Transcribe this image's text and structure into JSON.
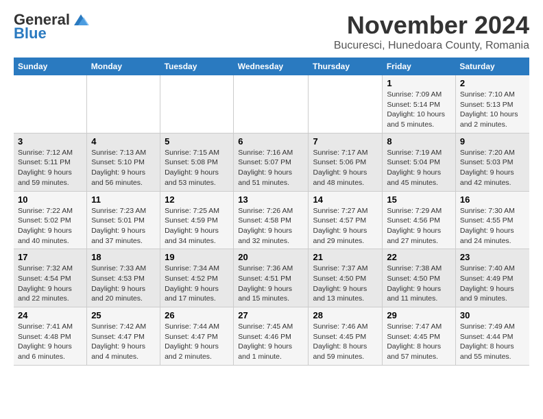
{
  "header": {
    "logo_general": "General",
    "logo_blue": "Blue",
    "month_title": "November 2024",
    "location": "Bucuresci, Hunedoara County, Romania"
  },
  "days_of_week": [
    "Sunday",
    "Monday",
    "Tuesday",
    "Wednesday",
    "Thursday",
    "Friday",
    "Saturday"
  ],
  "weeks": [
    [
      {
        "day": "",
        "info": ""
      },
      {
        "day": "",
        "info": ""
      },
      {
        "day": "",
        "info": ""
      },
      {
        "day": "",
        "info": ""
      },
      {
        "day": "",
        "info": ""
      },
      {
        "day": "1",
        "info": "Sunrise: 7:09 AM\nSunset: 5:14 PM\nDaylight: 10 hours\nand 5 minutes."
      },
      {
        "day": "2",
        "info": "Sunrise: 7:10 AM\nSunset: 5:13 PM\nDaylight: 10 hours\nand 2 minutes."
      }
    ],
    [
      {
        "day": "3",
        "info": "Sunrise: 7:12 AM\nSunset: 5:11 PM\nDaylight: 9 hours\nand 59 minutes."
      },
      {
        "day": "4",
        "info": "Sunrise: 7:13 AM\nSunset: 5:10 PM\nDaylight: 9 hours\nand 56 minutes."
      },
      {
        "day": "5",
        "info": "Sunrise: 7:15 AM\nSunset: 5:08 PM\nDaylight: 9 hours\nand 53 minutes."
      },
      {
        "day": "6",
        "info": "Sunrise: 7:16 AM\nSunset: 5:07 PM\nDaylight: 9 hours\nand 51 minutes."
      },
      {
        "day": "7",
        "info": "Sunrise: 7:17 AM\nSunset: 5:06 PM\nDaylight: 9 hours\nand 48 minutes."
      },
      {
        "day": "8",
        "info": "Sunrise: 7:19 AM\nSunset: 5:04 PM\nDaylight: 9 hours\nand 45 minutes."
      },
      {
        "day": "9",
        "info": "Sunrise: 7:20 AM\nSunset: 5:03 PM\nDaylight: 9 hours\nand 42 minutes."
      }
    ],
    [
      {
        "day": "10",
        "info": "Sunrise: 7:22 AM\nSunset: 5:02 PM\nDaylight: 9 hours\nand 40 minutes."
      },
      {
        "day": "11",
        "info": "Sunrise: 7:23 AM\nSunset: 5:01 PM\nDaylight: 9 hours\nand 37 minutes."
      },
      {
        "day": "12",
        "info": "Sunrise: 7:25 AM\nSunset: 4:59 PM\nDaylight: 9 hours\nand 34 minutes."
      },
      {
        "day": "13",
        "info": "Sunrise: 7:26 AM\nSunset: 4:58 PM\nDaylight: 9 hours\nand 32 minutes."
      },
      {
        "day": "14",
        "info": "Sunrise: 7:27 AM\nSunset: 4:57 PM\nDaylight: 9 hours\nand 29 minutes."
      },
      {
        "day": "15",
        "info": "Sunrise: 7:29 AM\nSunset: 4:56 PM\nDaylight: 9 hours\nand 27 minutes."
      },
      {
        "day": "16",
        "info": "Sunrise: 7:30 AM\nSunset: 4:55 PM\nDaylight: 9 hours\nand 24 minutes."
      }
    ],
    [
      {
        "day": "17",
        "info": "Sunrise: 7:32 AM\nSunset: 4:54 PM\nDaylight: 9 hours\nand 22 minutes."
      },
      {
        "day": "18",
        "info": "Sunrise: 7:33 AM\nSunset: 4:53 PM\nDaylight: 9 hours\nand 20 minutes."
      },
      {
        "day": "19",
        "info": "Sunrise: 7:34 AM\nSunset: 4:52 PM\nDaylight: 9 hours\nand 17 minutes."
      },
      {
        "day": "20",
        "info": "Sunrise: 7:36 AM\nSunset: 4:51 PM\nDaylight: 9 hours\nand 15 minutes."
      },
      {
        "day": "21",
        "info": "Sunrise: 7:37 AM\nSunset: 4:50 PM\nDaylight: 9 hours\nand 13 minutes."
      },
      {
        "day": "22",
        "info": "Sunrise: 7:38 AM\nSunset: 4:50 PM\nDaylight: 9 hours\nand 11 minutes."
      },
      {
        "day": "23",
        "info": "Sunrise: 7:40 AM\nSunset: 4:49 PM\nDaylight: 9 hours\nand 9 minutes."
      }
    ],
    [
      {
        "day": "24",
        "info": "Sunrise: 7:41 AM\nSunset: 4:48 PM\nDaylight: 9 hours\nand 6 minutes."
      },
      {
        "day": "25",
        "info": "Sunrise: 7:42 AM\nSunset: 4:47 PM\nDaylight: 9 hours\nand 4 minutes."
      },
      {
        "day": "26",
        "info": "Sunrise: 7:44 AM\nSunset: 4:47 PM\nDaylight: 9 hours\nand 2 minutes."
      },
      {
        "day": "27",
        "info": "Sunrise: 7:45 AM\nSunset: 4:46 PM\nDaylight: 9 hours\nand 1 minute."
      },
      {
        "day": "28",
        "info": "Sunrise: 7:46 AM\nSunset: 4:45 PM\nDaylight: 8 hours\nand 59 minutes."
      },
      {
        "day": "29",
        "info": "Sunrise: 7:47 AM\nSunset: 4:45 PM\nDaylight: 8 hours\nand 57 minutes."
      },
      {
        "day": "30",
        "info": "Sunrise: 7:49 AM\nSunset: 4:44 PM\nDaylight: 8 hours\nand 55 minutes."
      }
    ]
  ]
}
